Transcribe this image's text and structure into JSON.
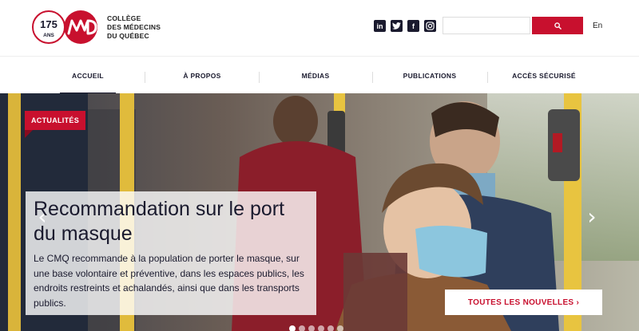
{
  "brand": {
    "anniversary_number": "175",
    "anniversary_label": "ANS",
    "name_lines": [
      "COLLÈGE",
      "DES MÉDECINS",
      "DU QUÉBEC"
    ],
    "accent_color": "#c8102e",
    "navy_color": "#1a1a2e"
  },
  "header": {
    "social_icons": [
      "linkedin-icon",
      "twitter-icon",
      "facebook-icon",
      "instagram-icon"
    ],
    "search": {
      "placeholder": "",
      "button_icon": "search-icon"
    },
    "language_link": "En"
  },
  "nav": {
    "items": [
      {
        "label": "ACCUEIL",
        "active": true
      },
      {
        "label": "À PROPOS",
        "active": false
      },
      {
        "label": "MÉDIAS",
        "active": false
      },
      {
        "label": "PUBLICATIONS",
        "active": false
      },
      {
        "label": "ACCÈS SÉCURISÉ",
        "active": false
      }
    ]
  },
  "hero": {
    "tag": "ACTUALITÉS",
    "title": "Recommandation sur le port du masque",
    "body": "Le CMQ recommande à la population de porter le masque, sur une base volontaire et préventive, dans les espaces publics, les endroits restreints et achalandés, ainsi que dans les transports publics.",
    "cta": "TOUTES LES NOUVELLES ›",
    "prev_icon": "chevron-left-icon",
    "next_icon": "chevron-right-icon",
    "slide_count": 6,
    "active_slide": 1
  }
}
